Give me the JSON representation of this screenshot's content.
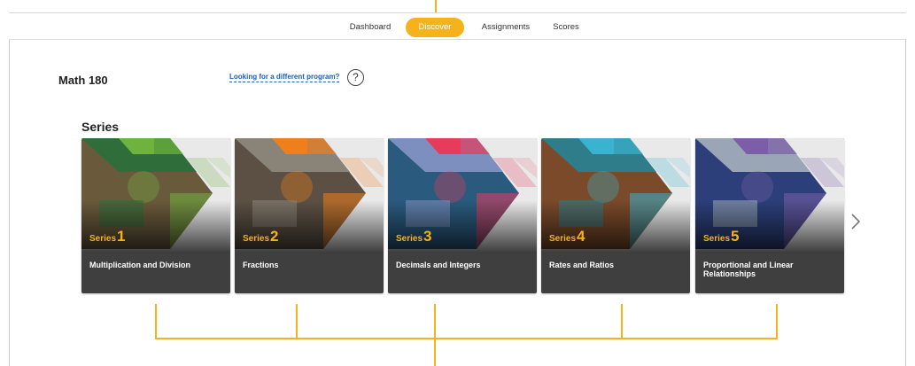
{
  "nav": {
    "items": [
      {
        "label": "Dashboard",
        "active": false
      },
      {
        "label": "Discover",
        "active": true
      },
      {
        "label": "Assignments",
        "active": false
      },
      {
        "label": "Scores",
        "active": false
      }
    ]
  },
  "program": {
    "title": "Math 180",
    "link_text": "Looking for a different program?",
    "help_icon": "question-circle-icon"
  },
  "series_section": {
    "heading": "Series",
    "cards": [
      {
        "prefix": "Series",
        "number": "1",
        "title": "Multiplication and Division",
        "accent": "#6fb33f",
        "art_top": "#2f6e3a",
        "art_bottom": "#6a5a3c"
      },
      {
        "prefix": "Series",
        "number": "2",
        "title": "Fractions",
        "accent": "#f07e1b",
        "art_top": "#8a8478",
        "art_bottom": "#5b5043"
      },
      {
        "prefix": "Series",
        "number": "3",
        "title": "Decimals and Integers",
        "accent": "#e63b5a",
        "art_top": "#7d8fbf",
        "art_bottom": "#2a5a7e"
      },
      {
        "prefix": "Series",
        "number": "4",
        "title": "Rates and Ratios",
        "accent": "#39b3cf",
        "art_top": "#2f7c8a",
        "art_bottom": "#7a4a2a"
      },
      {
        "prefix": "Series",
        "number": "5",
        "title": "Proportional and Linear Relationships",
        "accent": "#7b5ea7",
        "art_top": "#9aa6b5",
        "art_bottom": "#2c3f7a"
      }
    ],
    "next_icon": "chevron-right-icon"
  },
  "colors": {
    "brand": "#f6b21b",
    "card_bg": "#3f3f3f"
  }
}
